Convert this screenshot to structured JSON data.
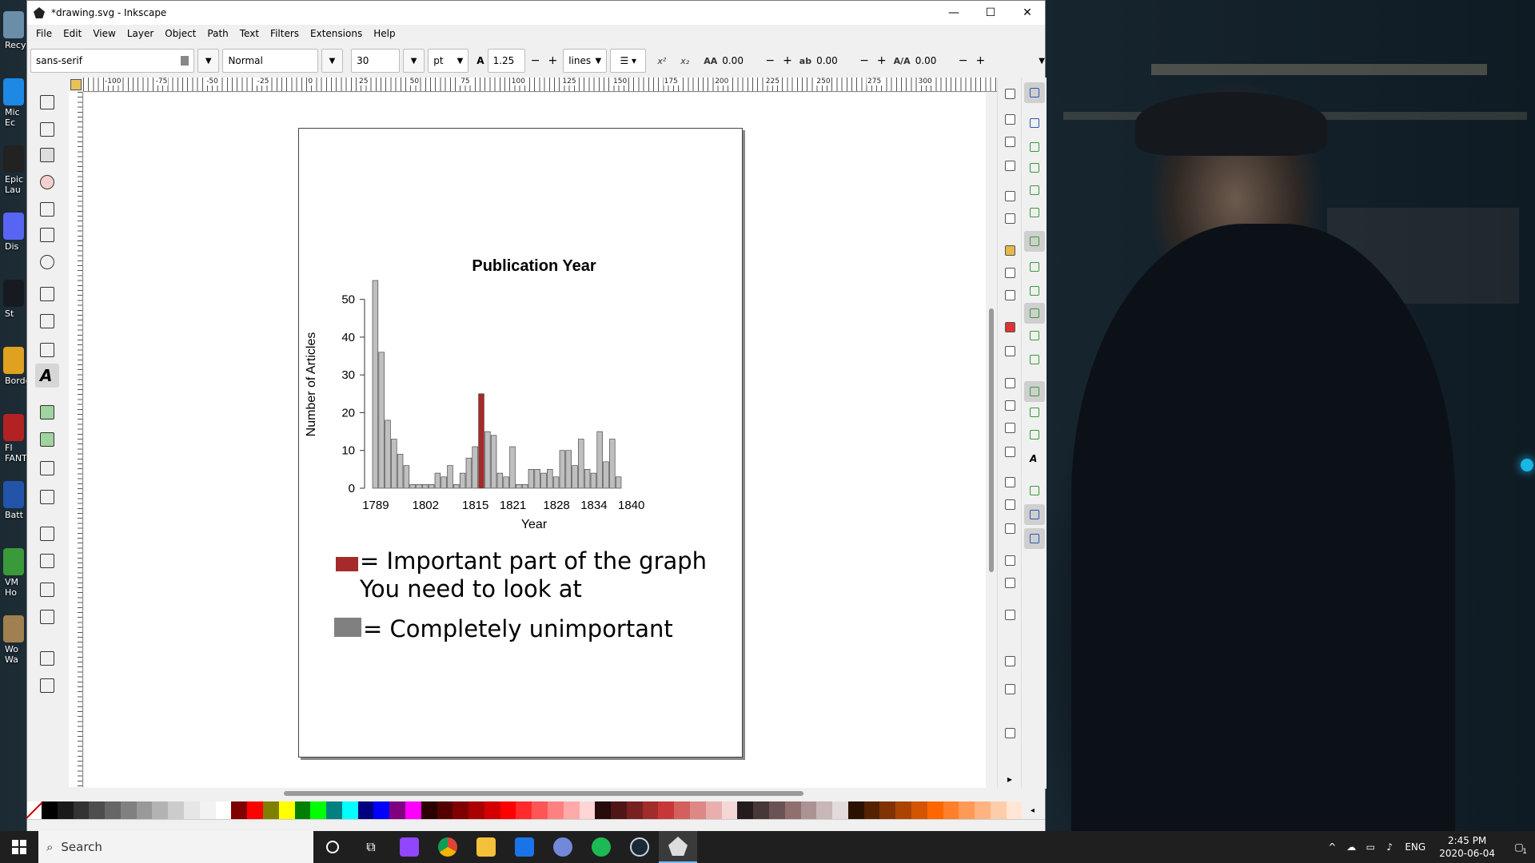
{
  "window": {
    "title": "*drawing.svg - Inkscape",
    "minimize": "—",
    "maximize": "☐",
    "close": "✕"
  },
  "menu": [
    "File",
    "Edit",
    "View",
    "Layer",
    "Object",
    "Path",
    "Text",
    "Filters",
    "Extensions",
    "Help"
  ],
  "text_toolbar": {
    "font_family": "sans-serif",
    "font_style": "Normal",
    "font_size": "30",
    "unit": "pt",
    "line_spacing": "1.25",
    "spacing_mode": "lines",
    "letter_spacing": "0.00",
    "word_spacing": "0.00",
    "kerning": "0.00",
    "superscript": "x²",
    "subscript": "x₂"
  },
  "ruler_labels": [
    "-100",
    "-75",
    "-50",
    "-25",
    "0",
    "25",
    "50",
    "75",
    "100",
    "125",
    "150",
    "175",
    "200",
    "225",
    "250",
    "275",
    "300"
  ],
  "chart_data": {
    "type": "bar",
    "title": "Publication Year",
    "xlabel": "Year",
    "ylabel": "Number of Articles",
    "ylim": [
      0,
      55
    ],
    "yticks": [
      0,
      10,
      20,
      30,
      40,
      50
    ],
    "xtick_labels": [
      "1789",
      "1802",
      "1815",
      "1821",
      "1828",
      "1834",
      "1840"
    ],
    "xtick_indices": [
      0,
      8,
      16,
      22,
      29,
      35,
      41
    ],
    "values": [
      55,
      36,
      18,
      13,
      9,
      6,
      1,
      1,
      1,
      1,
      4,
      3,
      6,
      1,
      4,
      8,
      11,
      25,
      15,
      14,
      4,
      3,
      11,
      1,
      1,
      5,
      5,
      4,
      5,
      3,
      10,
      10,
      6,
      13,
      5,
      4,
      15,
      7,
      13,
      3
    ],
    "highlight_index": 17,
    "colors": {
      "normal": "#bfbfbf",
      "highlight": "#a52a2a",
      "stroke": "#333333"
    },
    "grid": false
  },
  "legend": {
    "important_line1": "= Important part of the graph",
    "important_line2": "You need to look at",
    "unimportant": "= Completely unimportant",
    "important_color": "#a52a2a",
    "unimportant_color": "#808080"
  },
  "desktop_icons": [
    {
      "label": "Recy"
    },
    {
      "label": "Mic Ec"
    },
    {
      "label": "Epic Lau"
    },
    {
      "label": "Dis"
    },
    {
      "label": "St"
    },
    {
      "label": "Borde"
    },
    {
      "label": "FI FANTA"
    },
    {
      "label": "Batt"
    },
    {
      "label": "VM Ho"
    },
    {
      "label": "Wo Wa"
    }
  ],
  "taskbar": {
    "search_placeholder": "Search",
    "language": "ENG",
    "time": "2:45 PM",
    "date": "2020-06-04",
    "notification_count": "1"
  }
}
